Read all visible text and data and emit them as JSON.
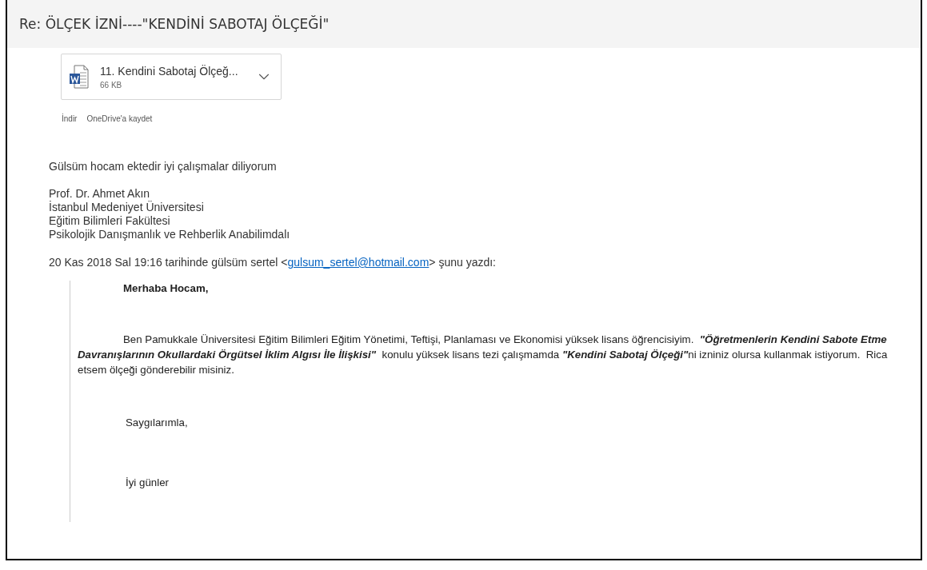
{
  "subject": "Re: ÖLÇEK İZNİ----\"KENDİNİ SABOTAJ ÖLÇEĞİ\"",
  "attachment": {
    "name": "11. Kendini Sabotaj Ölçeğ...",
    "size": "66 KB"
  },
  "attachment_actions": [
    "İndir",
    "OneDrive'a kaydet"
  ],
  "body": {
    "greeting": "Gülsüm hocam ektedir iyi çalışmalar diliyorum",
    "signature": [
      "Prof. Dr. Ahmet Akın",
      "İstanbul Medeniyet Üniversitesi",
      "Eğitim Bilimleri Fakültesi",
      "Psikolojik Danışmanlık ve Rehberlik Anabilimdalı"
    ]
  },
  "quote_header": {
    "prefix": "20 Kas 2018 Sal 19:16 tarihinde gülsüm sertel <",
    "email": "gulsum_sertel@hotmail.com",
    "suffix": "> şunu yazdı:"
  },
  "quoted": {
    "salutation": "Merhaba Hocam,",
    "paragraph": "Ben Pamukkale Üniversitesi Eğitim Bilimleri Eğitim Yönetimi, Teftişi, Planlaması ve Ekonomisi yüksek lisans öğrencisiyim.  **\"Öğretmenlerin Kendini Sabote Etme Davranışlarının Okullardaki Örgütsel İklim Algısı İle İlişkisi\"**  konulu yüksek lisans tezi çalışmamda **\"Kendini Sabotaj Ölçeği\"**ni izniniz olursa kullanmak istiyorum.  Rica etsem ölçeği gönderebilir misiniz.",
    "closing": "Saygılarımla,",
    "farewell": "İyi günler"
  }
}
